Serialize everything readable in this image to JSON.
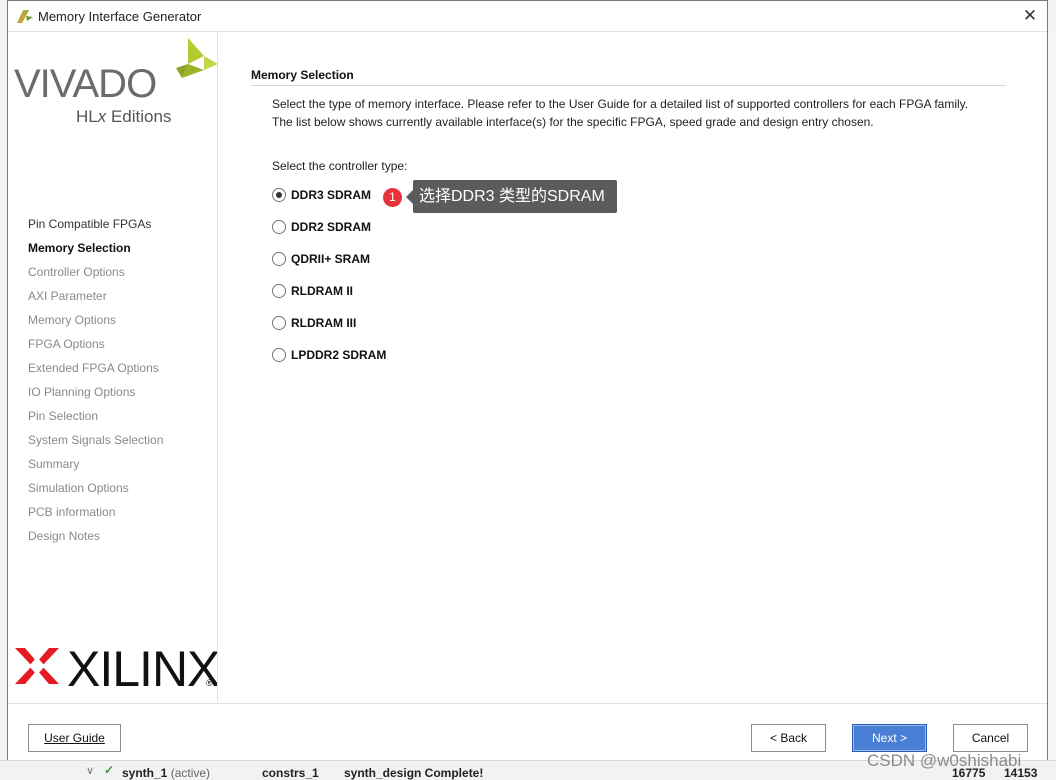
{
  "dialog": {
    "title": "Memory Interface Generator",
    "close_glyph": "✕"
  },
  "logos": {
    "vivado": "VIVADO",
    "vivado_subtitle_prefix": "HL",
    "vivado_subtitle_x": "x",
    "vivado_subtitle_suffix": " Editions",
    "xilinx": "XILINX",
    "xilinx_reg": "®"
  },
  "steps": [
    {
      "label": "Pin Compatible FPGAs",
      "state": "done"
    },
    {
      "label": "Memory Selection",
      "state": "current"
    },
    {
      "label": "Controller Options",
      "state": "pending"
    },
    {
      "label": "AXI Parameter",
      "state": "pending"
    },
    {
      "label": "Memory Options",
      "state": "pending"
    },
    {
      "label": "FPGA Options",
      "state": "pending"
    },
    {
      "label": "Extended FPGA Options",
      "state": "pending"
    },
    {
      "label": "IO Planning Options",
      "state": "pending"
    },
    {
      "label": "Pin Selection",
      "state": "pending"
    },
    {
      "label": "System Signals Selection",
      "state": "pending"
    },
    {
      "label": "Summary",
      "state": "pending"
    },
    {
      "label": "Simulation Options",
      "state": "pending"
    },
    {
      "label": "PCB information",
      "state": "pending"
    },
    {
      "label": "Design Notes",
      "state": "pending"
    }
  ],
  "main": {
    "section_title": "Memory Selection",
    "description_line1": "Select the type of memory interface. Please refer to the User Guide for a detailed list of supported controllers for each FPGA family.",
    "description_line2": "The list below shows currently available interface(s) for the specific FPGA, speed grade and design entry chosen.",
    "select_label": "Select the controller type:",
    "controller_options": [
      {
        "label": "DDR3 SDRAM",
        "selected": true
      },
      {
        "label": "DDR2 SDRAM",
        "selected": false
      },
      {
        "label": "QDRII+ SRAM",
        "selected": false
      },
      {
        "label": "RLDRAM II",
        "selected": false
      },
      {
        "label": "RLDRAM III",
        "selected": false
      },
      {
        "label": "LPDDR2 SDRAM",
        "selected": false
      }
    ]
  },
  "annotation": {
    "badge": "1",
    "text": "选择DDR3 类型的SDRAM"
  },
  "footer": {
    "user_guide": "User Guide",
    "back": "< Back",
    "next": "Next >",
    "cancel": "Cancel"
  },
  "background_app": {
    "row_name": "synth_1",
    "row_status": "(active)",
    "constrs": "constrs_1",
    "message": "synth_design Complete!",
    "num1": "16775",
    "num2": "14153"
  },
  "watermark": "CSDN @w0shishabi",
  "colors": {
    "next_button": "#4a7fd6",
    "callout_bg": "#5b5b5b",
    "badge_red": "#e8323c",
    "xilinx_red": "#e31b23",
    "vivado_green": "#b5c930"
  }
}
